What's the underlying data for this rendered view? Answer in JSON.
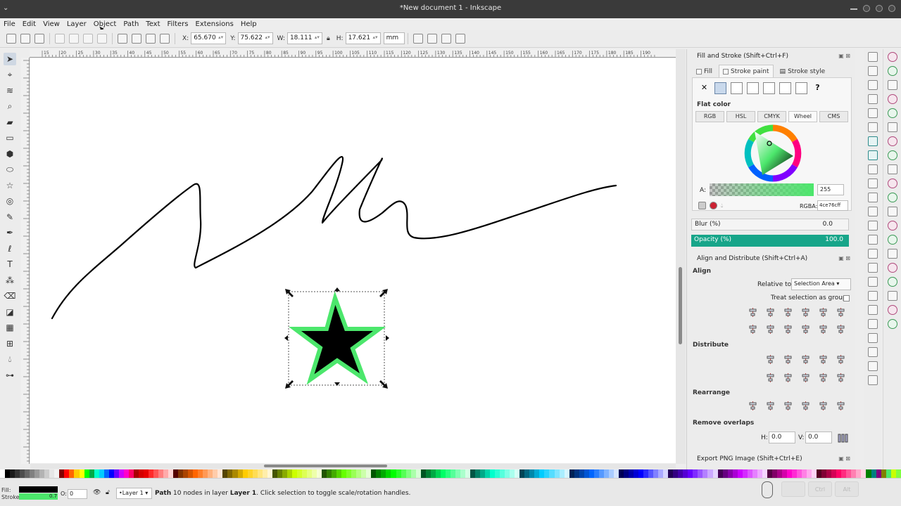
{
  "window": {
    "title": "*New document 1 - Inkscape"
  },
  "menu": [
    "File",
    "Edit",
    "View",
    "Layer",
    "Object",
    "Path",
    "Text",
    "Filters",
    "Extensions",
    "Help"
  ],
  "toolbar": {
    "x_label": "X:",
    "x_value": "65.670",
    "y_label": "Y:",
    "y_value": "75.622",
    "w_label": "W:",
    "w_value": "18.111",
    "h_label": "H:",
    "h_value": "17.621",
    "unit": "mm"
  },
  "tools": [
    "selector-tool",
    "node-tool",
    "tweak-tool",
    "zoom-tool",
    "measure-tool",
    "rectangle-tool",
    "3d-box-tool",
    "ellipse-tool",
    "star-tool",
    "spiral-tool",
    "pencil-tool",
    "pen-tool",
    "calligraphy-tool",
    "text-tool",
    "spray-tool",
    "eraser-tool",
    "paint-bucket-tool",
    "gradient-tool",
    "mesh-tool",
    "dropper-tool",
    "connector-tool"
  ],
  "ruler": {
    "h_ticks": [
      "15",
      "20",
      "25",
      "30",
      "35",
      "40",
      "45",
      "50",
      "55",
      "60",
      "65",
      "70",
      "75",
      "80",
      "85",
      "90",
      "95",
      "100",
      "105",
      "110",
      "115",
      "120",
      "125",
      "130",
      "135",
      "140",
      "145",
      "150",
      "155",
      "160",
      "165",
      "170",
      "175",
      "180",
      "185",
      "190"
    ]
  },
  "fill_stroke": {
    "header": "Fill and Stroke (Shift+Ctrl+F)",
    "tabs": [
      "Fill",
      "Stroke paint",
      "Stroke style"
    ],
    "active_tab": "Stroke paint",
    "mode_label": "Flat color",
    "models": [
      "RGB",
      "HSL",
      "CMYK",
      "Wheel",
      "CMS"
    ],
    "active_model": "Wheel",
    "alpha_label": "A:",
    "alpha_value": "255",
    "rgba_label": "RGBA:",
    "rgba_value": "4ce76cff",
    "blur_label": "Blur (%)",
    "blur_value": "0.0",
    "opacity_label": "Opacity (%)",
    "opacity_value": "100.0"
  },
  "align": {
    "header": "Align and Distribute (Shift+Ctrl+A)",
    "align_label": "Align",
    "relative_label": "Relative to:",
    "relative_value": "Selection Area",
    "treat_label": "Treat selection as group:",
    "distribute_label": "Distribute",
    "rearrange_label": "Rearrange",
    "overlap_label": "Remove overlaps",
    "h_label": "H:",
    "h_value": "0.0",
    "v_label": "V:",
    "v_value": "0.0"
  },
  "export": {
    "header": "Export PNG Image (Shift+Ctrl+E)"
  },
  "status": {
    "fill_label": "Fill:",
    "stroke_label": "Stroke:",
    "stroke_width": "0.7",
    "opacity_label": "O:",
    "opacity_value": "0",
    "layer": "•Layer 1",
    "msg_obj": "Path",
    "msg_mid": " 10 nodes in layer ",
    "msg_layer": "Layer 1",
    "msg_end": ". Click selection to toggle scale/rotation handles.",
    "keys": [
      "",
      "Ctrl",
      "Alt"
    ]
  },
  "colors": {
    "stroke": "#4ce76c",
    "fill": "#000000",
    "accent": "#17a589"
  }
}
